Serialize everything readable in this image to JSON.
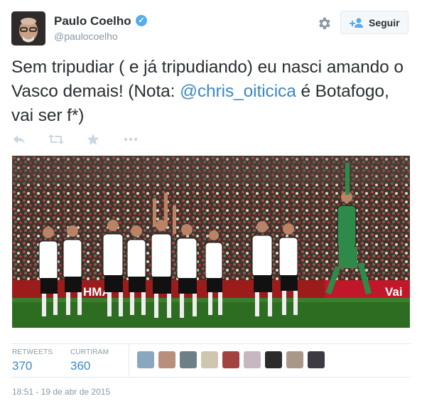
{
  "author": {
    "name": "Paulo Coelho",
    "handle": "@paulocoelho",
    "verified_icon": "verified-badge-icon",
    "avatar_icon": "avatar-image"
  },
  "header": {
    "settings_icon": "gear-icon",
    "follow_label": "Seguir",
    "follow_icon": "add-user-icon"
  },
  "tweet": {
    "text_before": "Sem  tripudiar ( e já tripudiando) eu nasci amando o Vasco demais! (Nota: ",
    "mention": "@chris_oiticica",
    "text_after": " é Botafogo, vai ser f*)",
    "photo_icon": "stadium-team-photo",
    "photo_banner_texts": [
      "HMA",
      "Vai"
    ]
  },
  "actions": [
    "reply-icon",
    "retweet-icon",
    "favorite-star-icon",
    "more-dots-icon"
  ],
  "stats": {
    "retweets_label": "RETWEETS",
    "retweets_value": "370",
    "favorites_label": "CURTIRAM",
    "favorites_value": "360"
  },
  "favoriters": [
    "avatar-1",
    "avatar-2",
    "avatar-3",
    "avatar-4",
    "avatar-5",
    "avatar-6",
    "avatar-7",
    "avatar-8",
    "avatar-9"
  ],
  "timestamp": "18:51 - 19 de abr de 2015",
  "colors": {
    "link": "#3b88c3",
    "muted": "#8899a6",
    "text": "#292f33",
    "verified": "#55acee"
  }
}
